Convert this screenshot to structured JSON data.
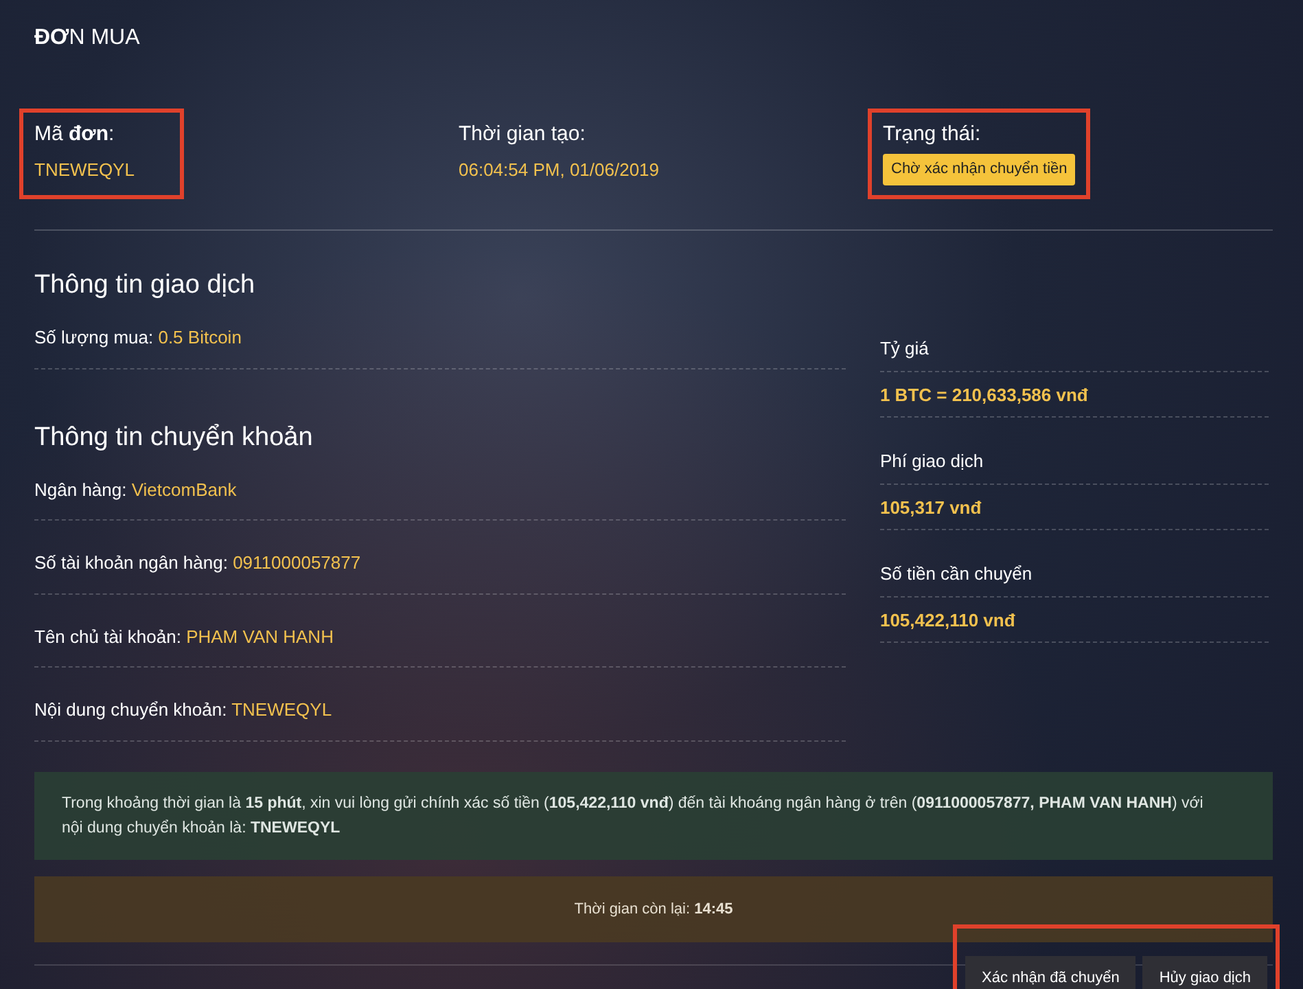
{
  "page_title": "**ĐƠ**N MUA",
  "summary": [
    {
      "label": "Mã **đơn**:",
      "value": "TNEWEQYL",
      "kind": "text",
      "highlighted": true
    },
    {
      "label": "Thời gian tạo:",
      "value": "06:04:54 PM, 01/06/2019",
      "kind": "text",
      "highlighted": false
    },
    {
      "label": "Trạng thái:",
      "value": "Chờ xác nhận chuyển tiền",
      "kind": "badge",
      "highlighted": true
    }
  ],
  "transaction": {
    "title": "Thông tin giao dịch",
    "fields": [
      {
        "label": "Số lượng mua:",
        "value": "0.5 Bitcoin"
      }
    ]
  },
  "transfer": {
    "title": "Thông tin chuyển khoản",
    "fields": [
      {
        "label": "Ngân hàng:",
        "value": "VietcomBank"
      },
      {
        "label": "Số tài khoản ngân hàng:",
        "value": "0911000057877"
      },
      {
        "label": "Tên chủ tài khoản:",
        "value": "PHAM VAN HANH"
      },
      {
        "label": "Nội dung chuyển khoản:",
        "value": "TNEWEQYL"
      }
    ]
  },
  "side": [
    {
      "label": "Tỷ giá",
      "value": "1 BTC = 210,633,586 vnđ"
    },
    {
      "label": "Phí giao dịch",
      "value": "105,317 vnđ"
    },
    {
      "label": "Số tiền cần chuyển",
      "value": "105,422,110 vnđ"
    }
  ],
  "notice": "Trong khoảng thời gian là **15 phút**, xin vui lòng gửi chính xác số tiền (**105,422,110 vnđ**) đến tài khoáng ngân hàng ở trên (**0911000057877, PHAM VAN HANH**) với nội dung chuyển khoản là: **TNEWEQYL**",
  "countdown": "Thời gian còn lại: **14:45**",
  "actions": {
    "highlighted": true,
    "buttons": [
      "Xác nhận đã chuyển",
      "Hủy giao dịch"
    ]
  }
}
